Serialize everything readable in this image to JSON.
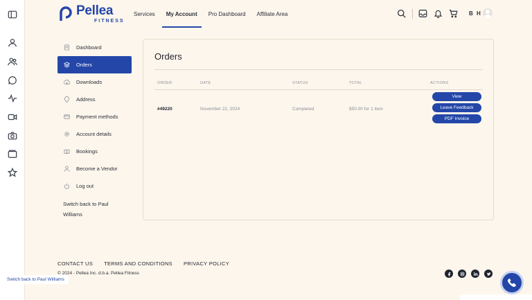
{
  "rail": {
    "icons": [
      "sidebar-toggle-icon",
      "user-icon",
      "users-icon",
      "chat-icon",
      "activity-icon",
      "video-icon",
      "camera-icon",
      "folder-icon",
      "star-icon"
    ]
  },
  "header": {
    "brand_name": "Pellea",
    "brand_sub": "FITNESS",
    "brand_color": "#2346a8",
    "nav": [
      {
        "label": "Services"
      },
      {
        "label": "My Account",
        "active": true
      },
      {
        "label": "Pro Dashboard"
      },
      {
        "label": "Affiliate Area"
      }
    ],
    "initials": "B H"
  },
  "menu": {
    "items": [
      {
        "label": "Dashboard",
        "icon": "dashboard-icon"
      },
      {
        "label": "Orders",
        "icon": "orders-icon",
        "active": true
      },
      {
        "label": "Downloads",
        "icon": "download-icon"
      },
      {
        "label": "Address",
        "icon": "location-icon"
      },
      {
        "label": "Payment methods",
        "icon": "card-icon"
      },
      {
        "label": "Account details",
        "icon": "gear-icon"
      },
      {
        "label": "Bookings",
        "icon": "book-icon"
      },
      {
        "label": "Become a Vendor",
        "icon": "user-icon"
      },
      {
        "label": "Log out",
        "icon": "power-icon"
      }
    ],
    "switch_back": "Switch back to Paul Williams"
  },
  "orders": {
    "title": "Orders",
    "columns": {
      "order": "ORDER",
      "date": "DATE",
      "status": "STATUS",
      "total": "TOTAL",
      "actions": "ACTIONS"
    },
    "rows": [
      {
        "order": "#49220",
        "date": "November 22, 2024",
        "status": "Completed",
        "total": "$50.00 for 1 item",
        "actions": [
          "View",
          "Leave Feedback",
          "PDF Invoice"
        ]
      }
    ]
  },
  "footer": {
    "links": [
      "CONTACT US",
      "TERMS AND CONDITIONS",
      "PRIVACY POLICY"
    ],
    "copyright": "© 2024 - Pellea Inc. d.b.a. Pellea Fitness",
    "social": [
      "facebook-icon",
      "instagram-icon",
      "linkedin-icon",
      "twitter-icon"
    ]
  },
  "floating": {
    "switch_back": "Switch back to Paul Williams"
  }
}
